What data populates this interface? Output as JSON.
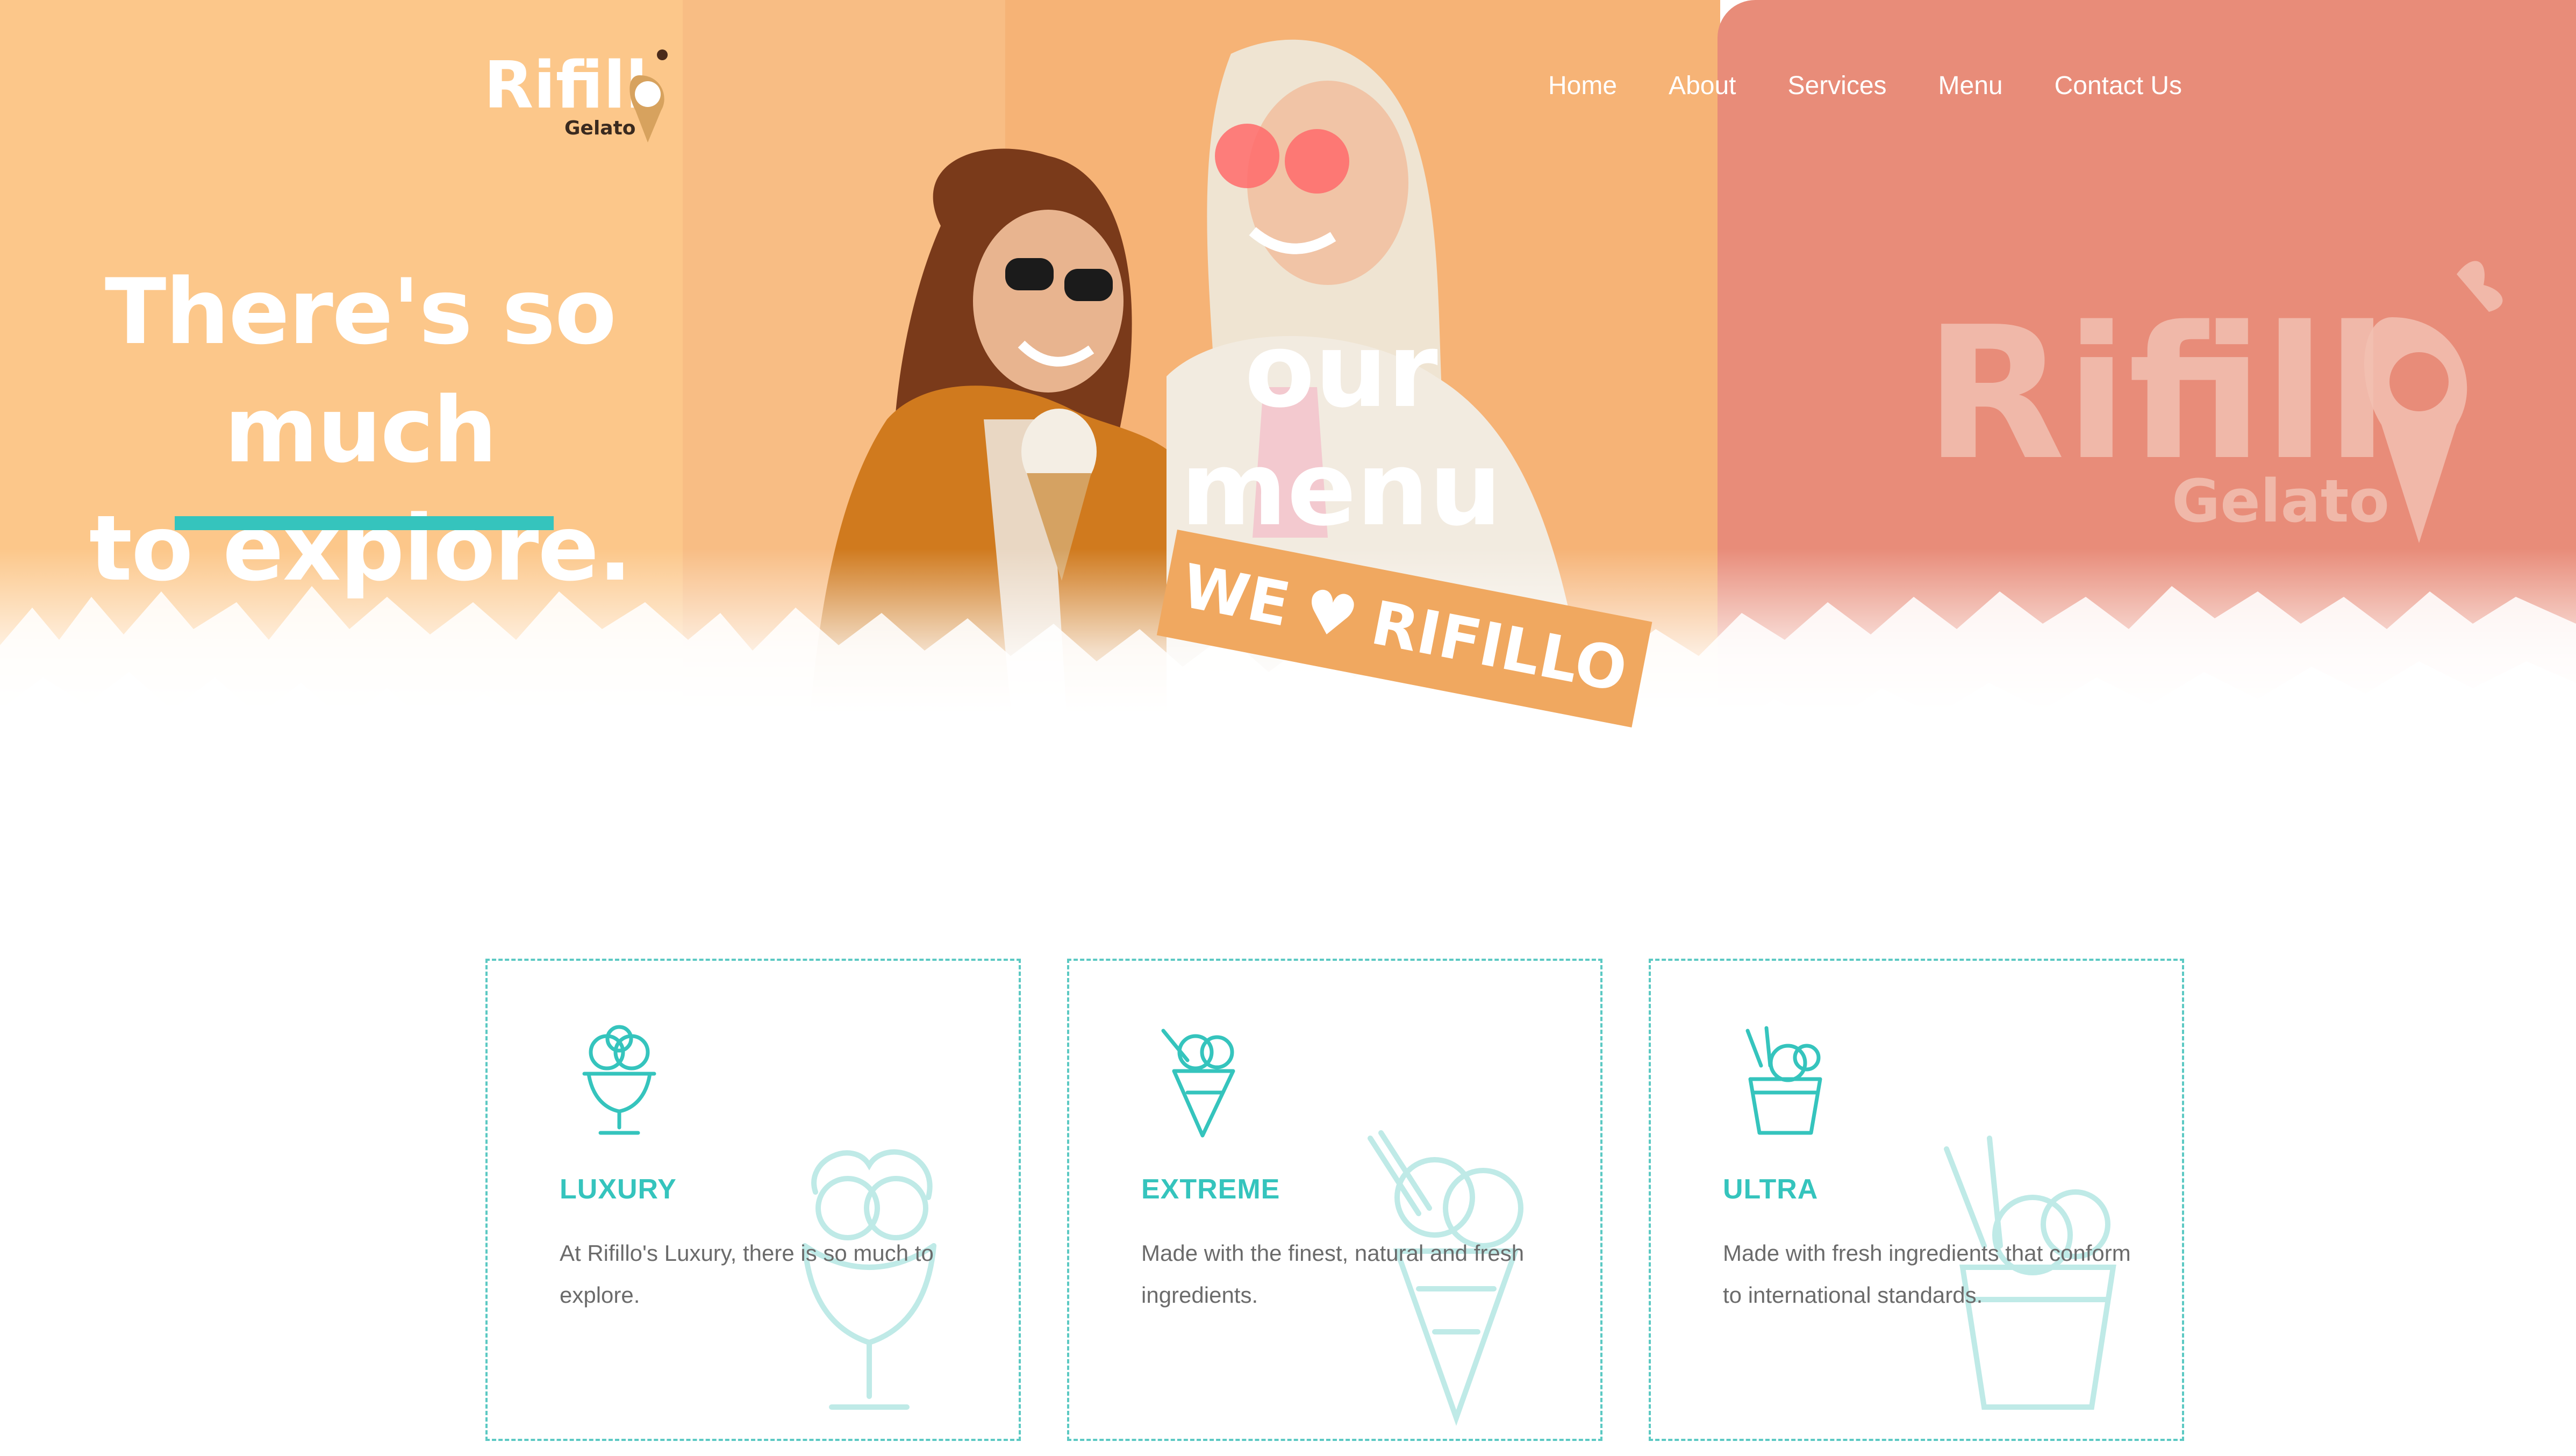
{
  "brand": {
    "name": "Rifillo",
    "sub": "Gelato"
  },
  "nav": {
    "items": [
      "Home",
      "About",
      "Services",
      "Menu",
      "Contact Us"
    ]
  },
  "hero": {
    "headline_line1": "There's so much",
    "headline_line2": "to explore.",
    "menu_title": "our menu",
    "banner_left": "WE",
    "banner_right": "RIFILLO"
  },
  "cards": [
    {
      "title": "LUXURY",
      "desc": "At Rifillo's Luxury, there is so much to explore.",
      "icon": "sundae-icon"
    },
    {
      "title": "EXTREME",
      "desc": "Made with the finest, natural and fresh ingredients.",
      "icon": "cone-icon"
    },
    {
      "title": "ULTRA",
      "desc": "Made with fresh ingredients that conform to international standards.",
      "icon": "cup-icon"
    }
  ],
  "colors": {
    "peach": "#fcc78a",
    "salmon": "#e88c79",
    "teal": "#35c4bd",
    "banner": "#f0a860"
  }
}
